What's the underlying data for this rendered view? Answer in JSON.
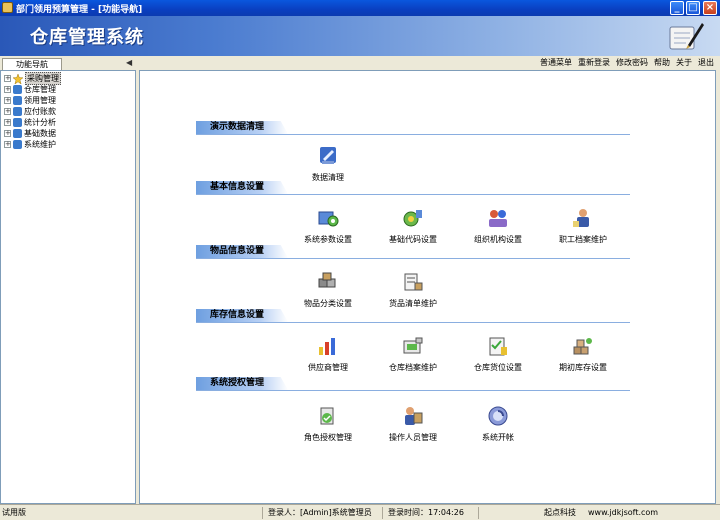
{
  "window": {
    "title": "部门领用预算管理 - [功能导航]",
    "buttons": {
      "minimize": "_",
      "maximize": "□",
      "close": "×"
    }
  },
  "banner": {
    "title": "仓库管理系统",
    "logo_icon": "pen-notebook-icon"
  },
  "nav_tab": {
    "label": "功能导航"
  },
  "menu": [
    {
      "label": "普通菜单"
    },
    {
      "label": "重新登录"
    },
    {
      "label": "修改密码"
    },
    {
      "label": "帮助"
    },
    {
      "label": "关于"
    },
    {
      "label": "退出"
    }
  ],
  "tree": [
    {
      "label": "采购管理",
      "icon": "star-icon",
      "color": "#F2C230",
      "selected": true
    },
    {
      "label": "仓库管理",
      "icon": "folder-icon",
      "color": "#3A7ACC"
    },
    {
      "label": "领用管理",
      "icon": "folder-icon",
      "color": "#3A7ACC"
    },
    {
      "label": "应付账款",
      "icon": "folder-icon",
      "color": "#3A7ACC"
    },
    {
      "label": "统计分析",
      "icon": "folder-icon",
      "color": "#3A7ACC"
    },
    {
      "label": "基础数据",
      "icon": "folder-icon",
      "color": "#3A7ACC"
    },
    {
      "label": "系统维护",
      "icon": "folder-icon",
      "color": "#3A7ACC"
    }
  ],
  "sections": [
    {
      "title": "演示数据清理",
      "items": [
        {
          "label": "数据清理",
          "icon": "data-clean-icon"
        }
      ]
    },
    {
      "title": "基本信息设置",
      "items": [
        {
          "label": "系统参数设置",
          "icon": "system-params-icon"
        },
        {
          "label": "基础代码设置",
          "icon": "base-code-icon"
        },
        {
          "label": "组织机构设置",
          "icon": "org-icon"
        },
        {
          "label": "职工档案维护",
          "icon": "employee-icon"
        }
      ]
    },
    {
      "title": "物品信息设置",
      "items": [
        {
          "label": "物品分类设置",
          "icon": "item-category-icon"
        },
        {
          "label": "货品清单维护",
          "icon": "goods-list-icon"
        }
      ]
    },
    {
      "title": "库存信息设置",
      "items": [
        {
          "label": "供应商管理",
          "icon": "supplier-icon"
        },
        {
          "label": "仓库档案维护",
          "icon": "warehouse-icon"
        },
        {
          "label": "仓库货位设置",
          "icon": "storage-location-icon"
        },
        {
          "label": "期初库存设置",
          "icon": "opening-stock-icon"
        }
      ]
    },
    {
      "title": "系统授权管理",
      "items": [
        {
          "label": "角色授权管理",
          "icon": "role-auth-icon"
        },
        {
          "label": "操作人员管理",
          "icon": "operator-icon"
        },
        {
          "label": "系统开帐",
          "icon": "system-open-icon"
        }
      ]
    }
  ],
  "status": {
    "edition": "试用版",
    "login_user": "登录人：[Admin]系统管理员",
    "login_time": "登录时间：17:04:26",
    "company": "起点科技",
    "website": "www.jdkjsoft.com"
  }
}
